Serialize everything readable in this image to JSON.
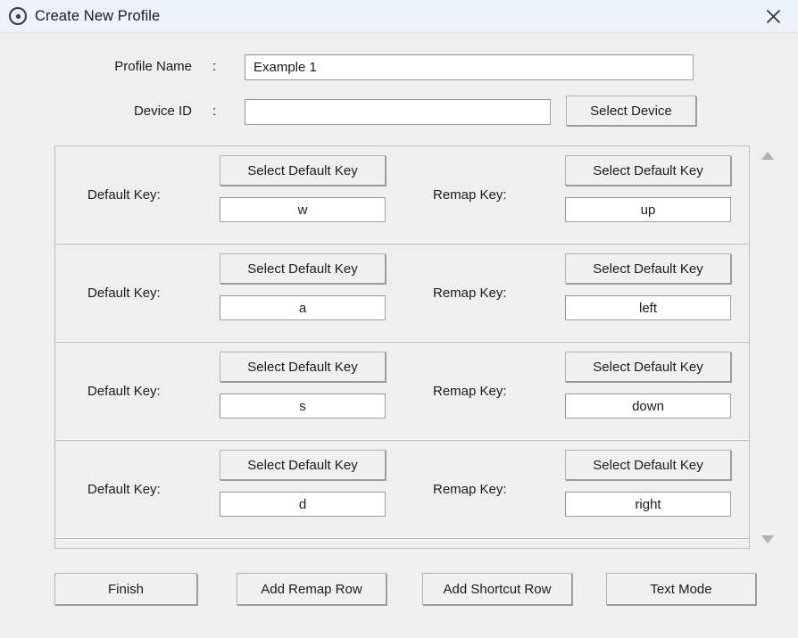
{
  "window": {
    "title": "Create New Profile",
    "icon": "target-circle-icon",
    "close_label": "×",
    "titlebar_color": "#edf1fa",
    "background_color": "#efefef"
  },
  "form": {
    "profile_name": {
      "label": "Profile Name",
      "separator": ":",
      "value": "Example 1",
      "placeholder": ""
    },
    "device_id": {
      "label": "Device ID",
      "separator": ":",
      "value": "",
      "placeholder": ""
    },
    "select_device_button": "Select Device"
  },
  "rows": {
    "default_key_label": "Default Key:",
    "remap_key_label": "Remap Key:",
    "select_button_label": "Select Default Key",
    "items": [
      {
        "default_key": "w",
        "remap_key": "up"
      },
      {
        "default_key": "a",
        "remap_key": "left"
      },
      {
        "default_key": "s",
        "remap_key": "down"
      },
      {
        "default_key": "d",
        "remap_key": "right"
      }
    ]
  },
  "scrollbar": {
    "up_arrow": "scroll-up-arrow",
    "down_arrow": "scroll-down-arrow"
  },
  "footer": {
    "finish": "Finish",
    "add_remap_row": "Add Remap Row",
    "add_shortcut_row": "Add Shortcut Row",
    "text_mode": "Text Mode"
  }
}
